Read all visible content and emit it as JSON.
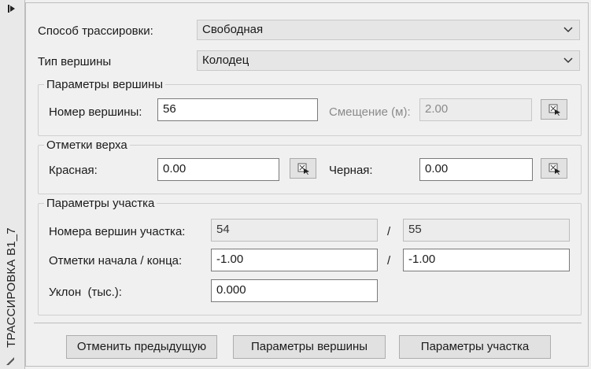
{
  "sidebar": {
    "title": "ТРАССИРОВКА В1_7"
  },
  "mode": {
    "label": "Способ трассировки:",
    "value": "Свободная"
  },
  "vertex_type": {
    "label": "Тип вершины",
    "value": "Колодец"
  },
  "vertex_params": {
    "title": "Параметры вершины",
    "number_label": "Номер вершины:",
    "number_value": "56",
    "offset_label": "Смещение (м):",
    "offset_value": "2.00"
  },
  "top_marks": {
    "title": "Отметки верха",
    "red_label": "Красная:",
    "red_value": "0.00",
    "black_label": "Черная:",
    "black_value": "0.00"
  },
  "section_params": {
    "title": "Параметры участка",
    "vertices_label": "Номера вершин участка:",
    "vertex_start": "54",
    "vertex_end": "55",
    "marks_label": "Отметки начала / конца:",
    "mark_start": "-1.00",
    "mark_end": "-1.00",
    "slash": "/",
    "slope_label": "Уклон  (тыс.):",
    "slope_value": "0.000"
  },
  "buttons": {
    "undo": "Отменить предыдущую",
    "vertex_params": "Параметры вершины",
    "section_params": "Параметры участка"
  },
  "icons": {
    "pin": "pin-icon",
    "chevron": "chevron-down-icon",
    "pick": "pick-point-icon"
  }
}
